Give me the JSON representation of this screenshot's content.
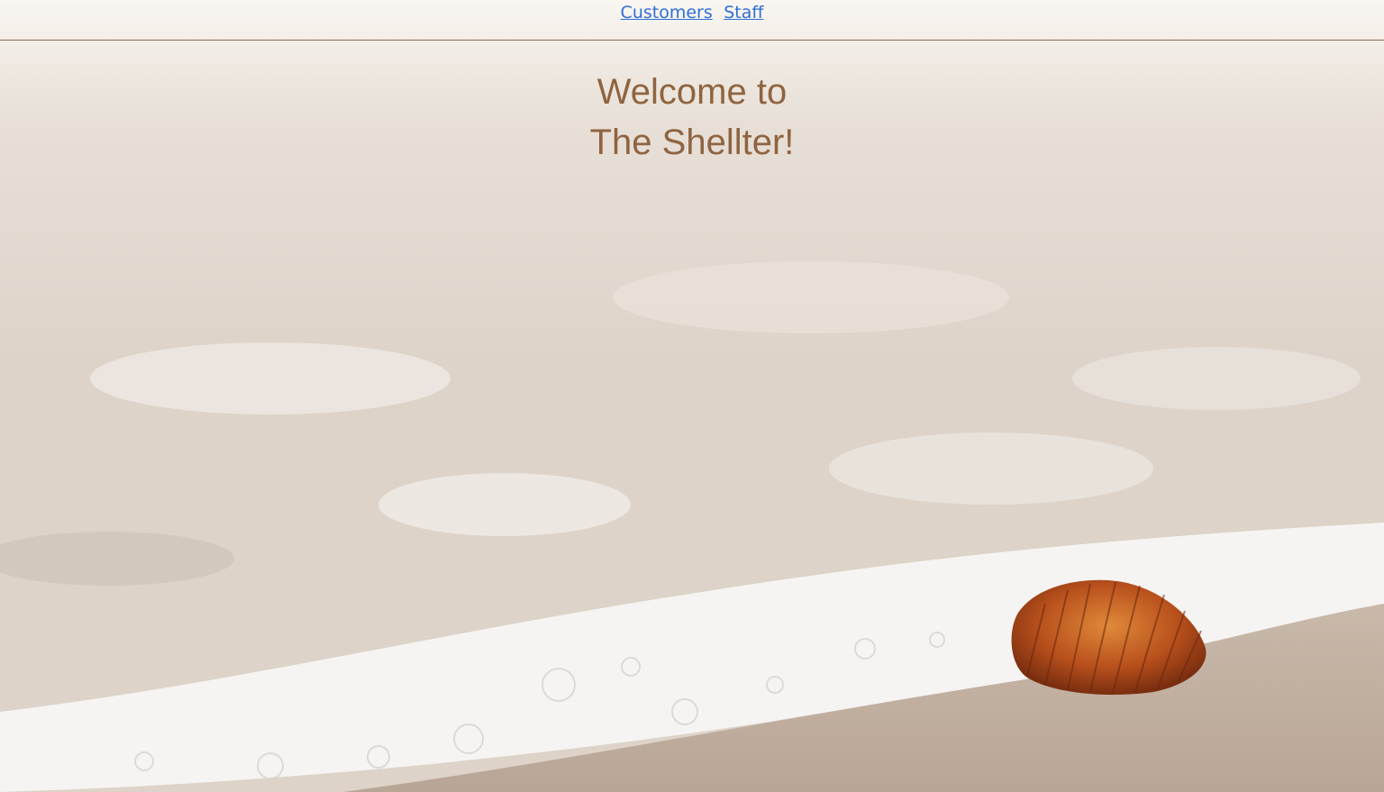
{
  "nav": {
    "links": [
      {
        "label": "Customers"
      },
      {
        "label": "Staff"
      }
    ]
  },
  "hero": {
    "line1": "Welcome to",
    "line2": "The Shellter!"
  },
  "colors": {
    "link": "#2f6fd6",
    "heading": "#8f6440",
    "divider": "#8a6a4e"
  }
}
